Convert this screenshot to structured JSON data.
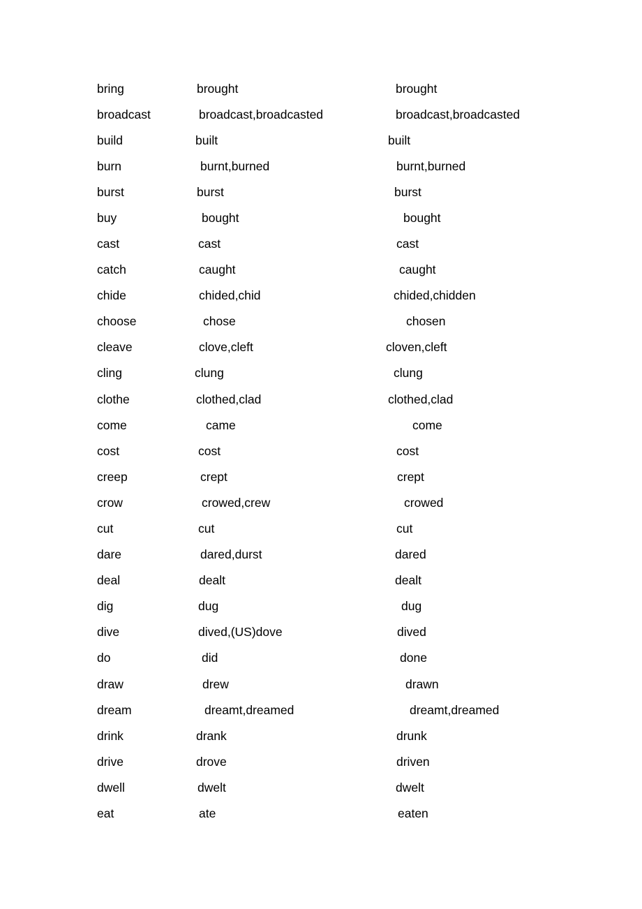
{
  "document": {
    "verbs": [
      {
        "base": "bring",
        "past": "brought",
        "participle": "brought"
      },
      {
        "base": "broadcast",
        "past": "broadcast,broadcasted",
        "participle": "broadcast,broadcasted"
      },
      {
        "base": "build",
        "past": "built",
        "participle": "built"
      },
      {
        "base": "burn",
        "past": "burnt,burned",
        "participle": "burnt,burned"
      },
      {
        "base": "burst",
        "past": "burst",
        "participle": "burst"
      },
      {
        "base": "buy",
        "past": "bought",
        "participle": "bought"
      },
      {
        "base": "cast",
        "past": "cast",
        "participle": "cast"
      },
      {
        "base": "catch",
        "past": "caught",
        "participle": "caught"
      },
      {
        "base": "chide",
        "past": "chided,chid",
        "participle": "chided,chidden"
      },
      {
        "base": "choose",
        "past": "chose",
        "participle": "chosen"
      },
      {
        "base": "cleave",
        "past": "clove,cleft",
        "participle": "cloven,cleft"
      },
      {
        "base": "cling",
        "past": "clung",
        "participle": "clung"
      },
      {
        "base": "clothe",
        "past": "clothed,clad",
        "participle": "clothed,clad"
      },
      {
        "base": "come",
        "past": "came",
        "participle": "come"
      },
      {
        "base": "cost",
        "past": "cost",
        "participle": "cost"
      },
      {
        "base": "creep",
        "past": "crept",
        "participle": "crept"
      },
      {
        "base": "crow",
        "past": "crowed,crew",
        "participle": "crowed"
      },
      {
        "base": "cut",
        "past": "cut",
        "participle": "cut"
      },
      {
        "base": "dare",
        "past": "dared,durst",
        "participle": "dared"
      },
      {
        "base": "deal",
        "past": "dealt",
        "participle": "dealt"
      },
      {
        "base": "dig",
        "past": "dug",
        "participle": "dug"
      },
      {
        "base": "dive",
        "past": "dived,(US)dove",
        "participle": "dived"
      },
      {
        "base": "do",
        "past": "did",
        "participle": "done"
      },
      {
        "base": "draw",
        "past": "drew",
        "participle": "drawn"
      },
      {
        "base": "dream",
        "past": "dreamt,dreamed",
        "participle": "dreamt,dreamed"
      },
      {
        "base": "drink",
        "past": "drank",
        "participle": "drunk"
      },
      {
        "base": "drive",
        "past": "drove",
        "participle": "driven"
      },
      {
        "base": "dwell",
        "past": "dwelt",
        "participle": "dwelt"
      },
      {
        "base": "eat",
        "past": "ate",
        "participle": "eaten"
      }
    ]
  }
}
